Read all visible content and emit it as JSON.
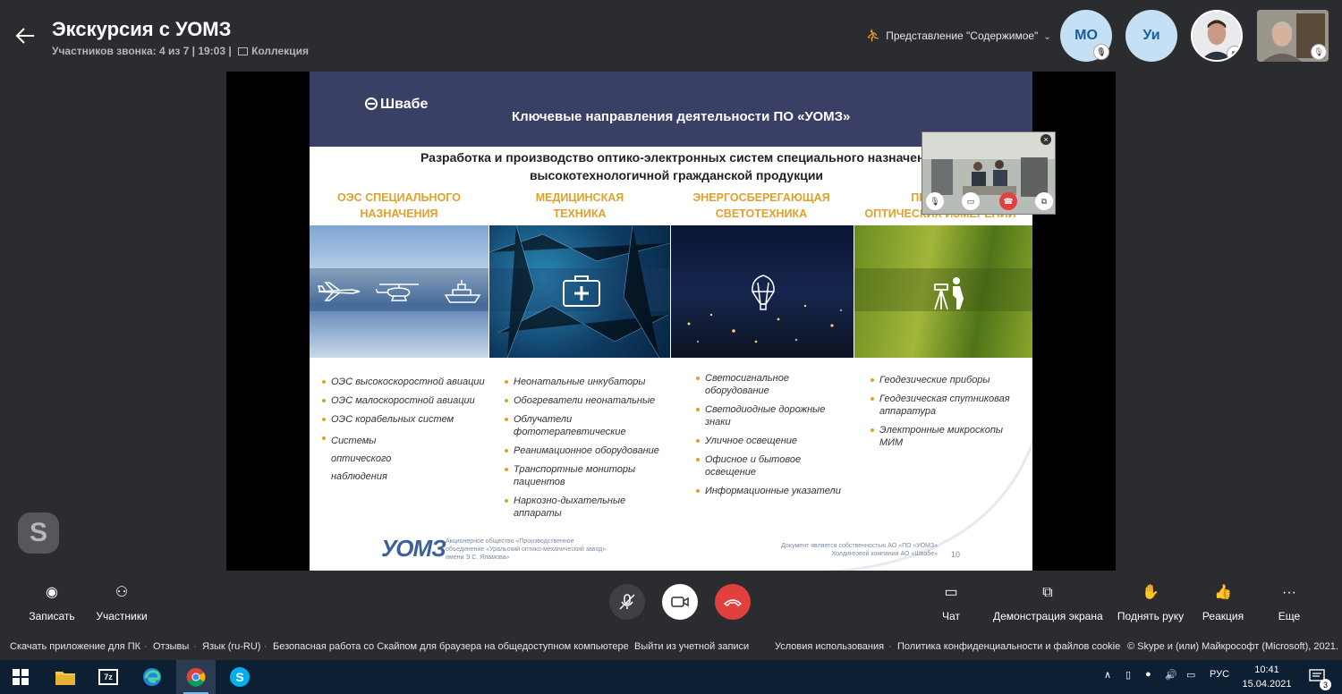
{
  "header": {
    "title": "Экскурсия с УОМЗ",
    "participants_info": "Участников звонка: 4 из 7 | 19:03 |",
    "collection_label": "Коллекция",
    "view_mode": "Представление \"Содержимое\""
  },
  "participants": [
    {
      "initials": "МО",
      "muted": true
    },
    {
      "initials": "Уи",
      "muted": false
    }
  ],
  "slide": {
    "brand": "Швабе",
    "title": "Ключевые направления деятельности ПО «УОМЗ»",
    "subtitle_line1": "Разработка и производство оптико-электронных систем специального назначени",
    "subtitle_line2": "высокотехнологичной гражданской продукции",
    "categories": [
      {
        "line1": "ОЭС СПЕЦИАЛЬНОГО",
        "line2": "НАЗНАЧЕНИЯ"
      },
      {
        "line1": "МЕДИЦИНСКАЯ",
        "line2": "ТЕХНИКА"
      },
      {
        "line1": "ЭНЕРГОСБЕРЕГАЮЩАЯ",
        "line2": "СВЕТОТЕХНИКА"
      },
      {
        "line1": "ПРИБОРЫ",
        "line2": "ОПТИЧЕСКИХ ИЗМЕРЕНИЙ"
      }
    ],
    "col1": [
      "ОЭС высокоскоростной авиации",
      "ОЭС малоскоростной авиации",
      "ОЭС корабельных систем",
      "Системы оптического наблюдения"
    ],
    "col2": [
      "Неонатальные инкубаторы",
      "Обогреватели неонатальные",
      "Облучатели фототерапевтические",
      "Реанимационное оборудование",
      "Транспортные мониторы пациентов",
      "Наркозно-дыхательные аппараты"
    ],
    "col3": [
      "Светосигнальное оборудование",
      "Светодиодные дорожные знаки",
      "Уличное освещение",
      "Офисное и бытовое освещение",
      "Информационные указатели"
    ],
    "col4": [
      "Геодезические приборы",
      "Геодезическая спутниковая аппаратура",
      "Электронные микроскопы МИМ"
    ],
    "footer_logo": "УОМЗ",
    "footer_text": "Акционерное общество «Производственное объединение «Уральский оптико-механический завод» имени Э.С. Яламова»",
    "footer_right": "Документ является собственностью АО «ПО «УОМЗ» Холдинговой компании АО «Швабе»",
    "page_number": "10"
  },
  "controls": {
    "record": "Записать",
    "participants": "Участники",
    "chat": "Чат",
    "screen_share": "Демонстрация экрана",
    "raise_hand": "Поднять руку",
    "reaction": "Реакция",
    "more": "Еще"
  },
  "footer_links": {
    "download": "Скачать приложение для ПК",
    "feedback": "Отзывы",
    "language": "Язык (ru-RU)",
    "safe": "Безопасная работа со Скайпом для браузера на общедоступном компьютере",
    "logout": "Выйти из учетной записи",
    "terms": "Условия использования",
    "privacy": "Политика конфиденциальности и файлов cookie",
    "copyright": "© Skype и (или) Майкрософт (Microsoft), 2021."
  },
  "taskbar": {
    "language": "РУС",
    "time": "10:41",
    "date": "15.04.2021",
    "notifications": "3"
  },
  "colors": {
    "accent_orange": "#e0a12a",
    "end_call_red": "#e23f3f",
    "avatar_bg": "#c5dff4"
  }
}
